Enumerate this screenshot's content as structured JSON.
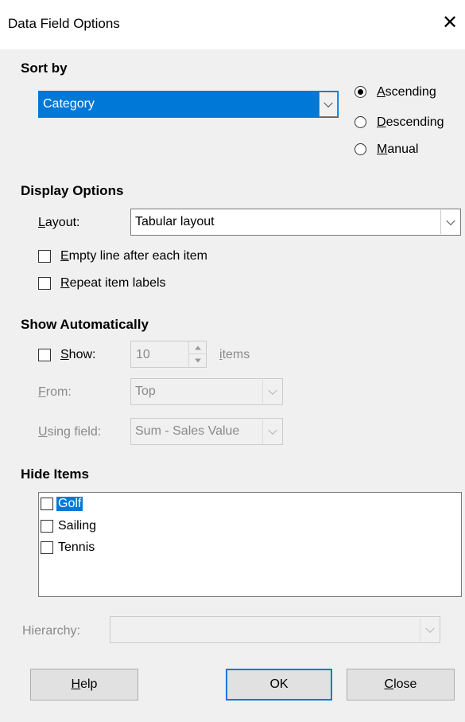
{
  "window": {
    "title": "Data Field Options",
    "close_glyph": "✕"
  },
  "sort_by": {
    "heading": "Sort by",
    "field_value": "Category",
    "options": [
      {
        "label": "Ascending",
        "checked": true
      },
      {
        "label": "Descending",
        "checked": false
      },
      {
        "label": "Manual",
        "checked": false
      }
    ]
  },
  "display_options": {
    "heading": "Display Options",
    "layout_label": "Layout:",
    "layout_value": "Tabular layout",
    "empty_line_label": "Empty line after each item",
    "repeat_labels_label": "Repeat item labels"
  },
  "show_automatically": {
    "heading": "Show Automatically",
    "show_label": "Show:",
    "show_count": "10",
    "items_label": "items",
    "from_label": "From:",
    "from_value": "Top",
    "using_field_label": "Using field:",
    "using_field_value": "Sum - Sales Value"
  },
  "hide_items": {
    "heading": "Hide Items",
    "items": [
      {
        "label": "Golf",
        "checked": false,
        "selected": true
      },
      {
        "label": "Sailing",
        "checked": false,
        "selected": false
      },
      {
        "label": "Tennis",
        "checked": false,
        "selected": false
      }
    ]
  },
  "hierarchy": {
    "label": "Hierarchy:",
    "value": ""
  },
  "buttons": {
    "help": "Help",
    "ok": "OK",
    "close": "Close"
  },
  "colors": {
    "accent": "#0078d7",
    "disabled_text": "#8a8a8a",
    "background": "#f0f0f0"
  }
}
